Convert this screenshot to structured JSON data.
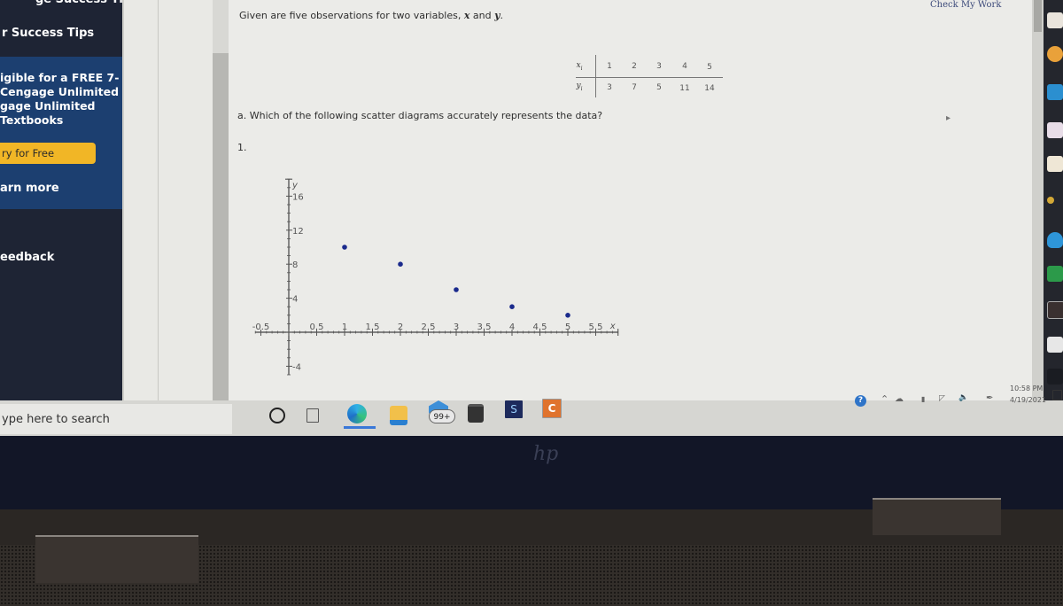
{
  "sidebar": {
    "top_cut_title": "ge Success Tips",
    "success_tips": "r Success Tips",
    "promo_lines": [
      "igible for a FREE 7-",
      "Cengage Unlimited",
      "gage Unlimited",
      "Textbooks"
    ],
    "try_button": "ry for Free",
    "learn_more": "arn more",
    "feedback": "eedback"
  },
  "header": {
    "check_work": "Check My Work"
  },
  "question": {
    "intro_prefix": "Given are five observations for two variables, ",
    "var_x": "x",
    "and": " and ",
    "var_y": "y",
    "period": ".",
    "part_a": "a. Which of the following scatter diagrams accurately represents the data?",
    "option_number": "1."
  },
  "data_table": {
    "x_header": "x",
    "x_sub": "i",
    "y_header": "y",
    "y_sub": "i",
    "x_values": [
      "1",
      "2",
      "3",
      "4",
      "5"
    ],
    "y_values": [
      "3",
      "7",
      "5",
      "11",
      "14"
    ]
  },
  "chart_data": {
    "type": "scatter",
    "title": "",
    "xlabel": "x",
    "ylabel": "y",
    "x": [
      1,
      2,
      3,
      4,
      5
    ],
    "y": [
      10,
      8,
      5,
      3,
      2
    ],
    "xlim": [
      -0.6,
      5.9
    ],
    "ylim": [
      -5,
      18
    ],
    "x_tick_labels": [
      "-0.5",
      "0.5",
      "1",
      "1.5",
      "2",
      "2.5",
      "3",
      "3.5",
      "4",
      "4.5",
      "5",
      "5.5"
    ],
    "x_tick_values": [
      -0.5,
      0.5,
      1,
      1.5,
      2,
      2.5,
      3,
      3.5,
      4,
      4.5,
      5,
      5.5
    ],
    "y_tick_labels": [
      "16",
      "12",
      "8",
      "4",
      "-4"
    ],
    "y_tick_values": [
      16,
      12,
      8,
      4,
      -4
    ],
    "grid": false,
    "point_color": "#1a2a8c"
  },
  "taskbar": {
    "search_placeholder": "ype here to search",
    "mail_badge": "99+",
    "store_app_letter": "C",
    "dark_app_letter": "S",
    "time": "10:58 PM",
    "date": "4/19/2021"
  },
  "device": {
    "logo": "hp"
  }
}
